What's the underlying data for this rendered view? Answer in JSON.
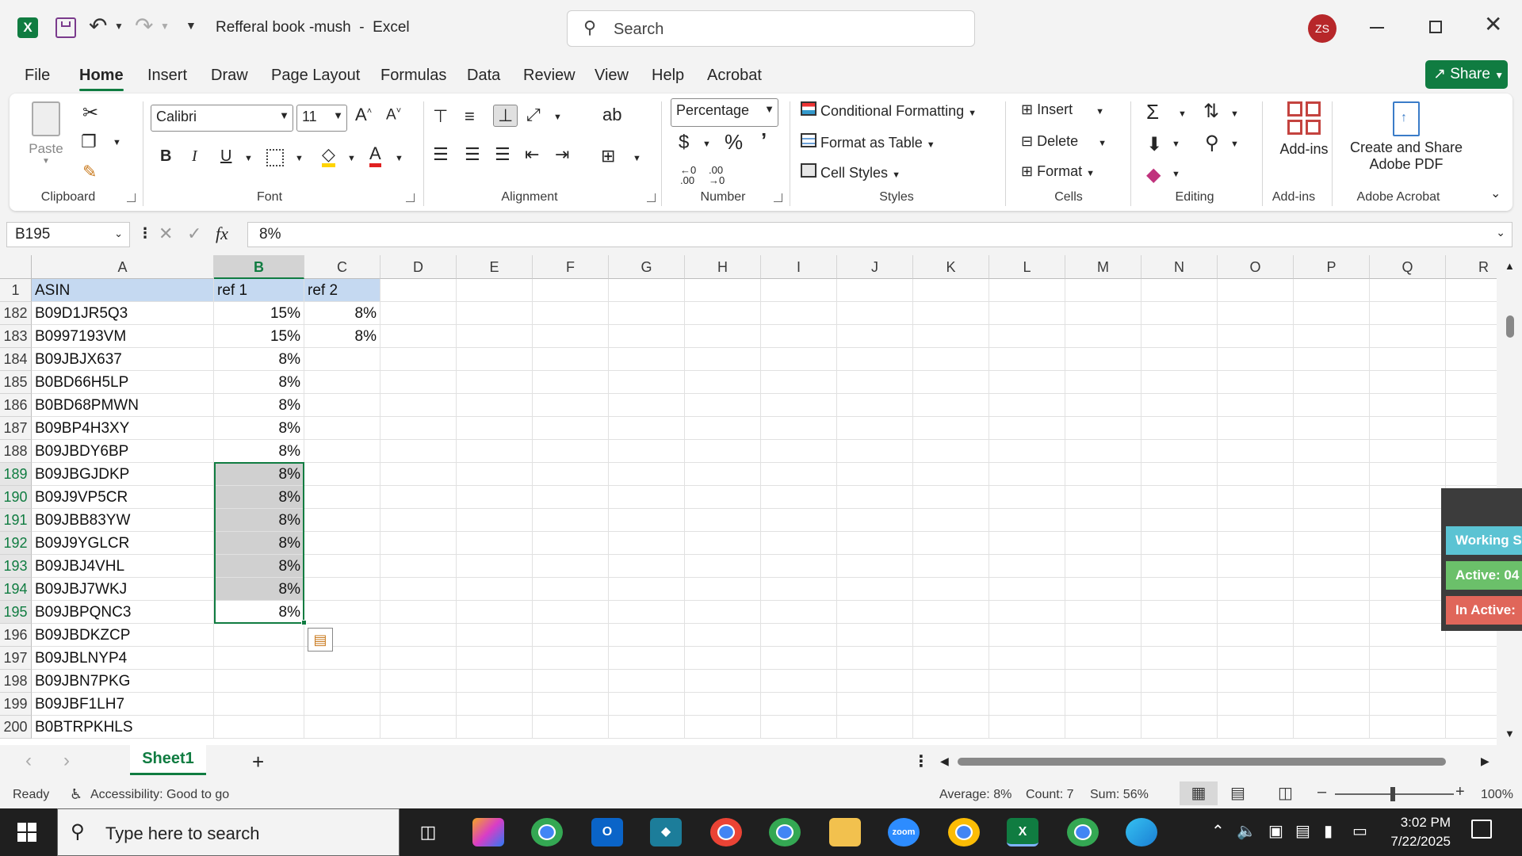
{
  "window": {
    "title": "Refferal book -mush  -  Excel",
    "search_placeholder": "Search",
    "user_initials": "ZS",
    "share_label": "Share"
  },
  "tabs": [
    "File",
    "Home",
    "Insert",
    "Draw",
    "Page Layout",
    "Formulas",
    "Data",
    "Review",
    "View",
    "Help",
    "Acrobat"
  ],
  "active_tab": "Home",
  "ribbon": {
    "clipboard": {
      "paste_label": "Paste",
      "group_label": "Clipboard"
    },
    "font": {
      "font_name": "Calibri",
      "font_size": "11",
      "group_label": "Font"
    },
    "alignment": {
      "group_label": "Alignment"
    },
    "number": {
      "format": "Percentage",
      "group_label": "Number"
    },
    "styles": {
      "conditional": "Conditional Formatting",
      "format_table": "Format as Table",
      "cell_styles": "Cell Styles",
      "group_label": "Styles"
    },
    "cells": {
      "insert": "Insert",
      "delete": "Delete",
      "format": "Format",
      "group_label": "Cells"
    },
    "editing": {
      "group_label": "Editing"
    },
    "addins": {
      "button_label": "Add-ins",
      "group_label": "Add-ins"
    },
    "acrobat": {
      "button_line1": "Create and Share",
      "button_line2": "Adobe PDF",
      "group_label": "Adobe Acrobat"
    },
    "accent_color": "#107c41"
  },
  "formula_bar": {
    "name_box": "B195",
    "formula": "8%",
    "fx": "fx"
  },
  "columns": [
    "A",
    "B",
    "C",
    "D",
    "E",
    "F",
    "G",
    "H",
    "I",
    "J",
    "K",
    "L",
    "M",
    "N",
    "O",
    "P",
    "Q",
    "R"
  ],
  "header_row": {
    "row_num": "1",
    "a": "ASIN",
    "b": "ref 1",
    "c": "ref 2"
  },
  "rows": [
    {
      "num": "182",
      "a": "B09D1JR5Q3",
      "b": "15%",
      "c": "8%"
    },
    {
      "num": "183",
      "a": "B0997193VM",
      "b": "15%",
      "c": "8%"
    },
    {
      "num": "184",
      "a": "B09JBJX637",
      "b": "8%",
      "c": ""
    },
    {
      "num": "185",
      "a": "B0BD66H5LP",
      "b": "8%",
      "c": ""
    },
    {
      "num": "186",
      "a": "B0BD68PMWN",
      "b": "8%",
      "c": ""
    },
    {
      "num": "187",
      "a": "B09BP4H3XY",
      "b": "8%",
      "c": ""
    },
    {
      "num": "188",
      "a": "B09JBDY6BP",
      "b": "8%",
      "c": ""
    },
    {
      "num": "189",
      "a": "B09JBGJDKP",
      "b": "8%",
      "c": ""
    },
    {
      "num": "190",
      "a": "B09J9VP5CR",
      "b": "8%",
      "c": ""
    },
    {
      "num": "191",
      "a": "B09JBB83YW",
      "b": "8%",
      "c": ""
    },
    {
      "num": "192",
      "a": "B09J9YGLCR",
      "b": "8%",
      "c": ""
    },
    {
      "num": "193",
      "a": "B09JBJ4VHL",
      "b": "8%",
      "c": ""
    },
    {
      "num": "194",
      "a": "B09JBJ7WKJ",
      "b": "8%",
      "c": ""
    },
    {
      "num": "195",
      "a": "B09JBPQNC3",
      "b": "8%",
      "c": ""
    },
    {
      "num": "196",
      "a": "B09JBDKZCP",
      "b": "",
      "c": ""
    },
    {
      "num": "197",
      "a": "B09JBLNYP4",
      "b": "",
      "c": ""
    },
    {
      "num": "198",
      "a": "B09JBN7PKG",
      "b": "",
      "c": ""
    },
    {
      "num": "199",
      "a": "B09JBF1LH7",
      "b": "",
      "c": ""
    },
    {
      "num": "200",
      "a": "B0BTRPKHLS",
      "b": "",
      "c": ""
    }
  ],
  "overlay": {
    "working": "Working S",
    "active": "Active: 04",
    "inactive": "In Active:"
  },
  "sheet": {
    "name": "Sheet1",
    "add": "+"
  },
  "status": {
    "ready": "Ready",
    "accessibility": "Accessibility: Good to go",
    "average": "Average: 8%",
    "count": "Count: 7",
    "sum": "Sum: 56%",
    "zoom": "100%"
  },
  "taskbar": {
    "search_placeholder": "Type here to search",
    "time": "3:02 PM",
    "date": "7/22/2025"
  }
}
